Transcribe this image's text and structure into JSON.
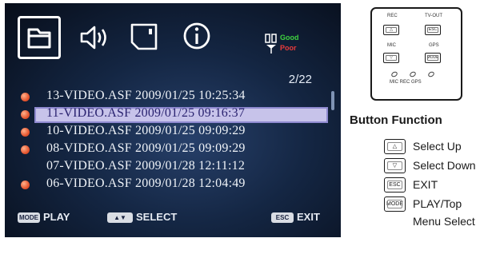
{
  "screen": {
    "tabs": [
      {
        "icon": "folder-icon",
        "active": true
      },
      {
        "icon": "speaker-icon",
        "active": false
      },
      {
        "icon": "sd-card-icon",
        "active": false
      },
      {
        "icon": "info-icon",
        "active": false
      }
    ],
    "signal_legend": {
      "good": "Good",
      "poor": "Poor"
    },
    "page_counter": "2/22",
    "files": [
      {
        "name": "13-VIDEO.ASF 2009/01/25 10:25:34",
        "dot": true,
        "selected": false
      },
      {
        "name": "11-VIDEO.ASF 2009/01/25 09:16:37",
        "dot": true,
        "selected": true
      },
      {
        "name": "10-VIDEO.ASF 2009/01/25 09:09:29",
        "dot": true,
        "selected": false
      },
      {
        "name": "08-VIDEO.ASF 2009/01/25 09:09:29",
        "dot": true,
        "selected": false
      },
      {
        "name": "07-VIDEO.ASF 2009/01/28 12:11:12",
        "dot": false,
        "selected": false
      },
      {
        "name": "06-VIDEO.ASF 2009/01/28 12:04:49",
        "dot": true,
        "selected": false
      }
    ],
    "bottom_bar": {
      "mode_key": "MODE",
      "play_label": "PLAY",
      "arrow_key": "▲▼",
      "select_label": "SELECT",
      "esc_key": "ESC",
      "exit_label": "EXIT"
    }
  },
  "remote": {
    "labels": {
      "rec": "REC",
      "tv_out": "TV-OUT",
      "mic": "MIC",
      "gps": "GPS"
    },
    "buttons": {
      "up": "△",
      "esc": "ESC",
      "down": "▽",
      "mode": "MODE"
    },
    "leds_label": "MIC  REC  GPS"
  },
  "button_function": {
    "title": "Button Function",
    "items": [
      {
        "key": "△",
        "text": "Select  Up"
      },
      {
        "key": "▽",
        "text": "Select  Down"
      },
      {
        "key": "ESC",
        "text": "EXIT"
      },
      {
        "key": "MODE",
        "text": "PLAY/Top",
        "text2": "Menu Select"
      }
    ]
  },
  "colors": {
    "screen_bg": "#142643",
    "selection": "#c7c3ea",
    "record_dot": "#e2502a",
    "good": "#3fd23f",
    "poor": "#ea3b3b"
  }
}
